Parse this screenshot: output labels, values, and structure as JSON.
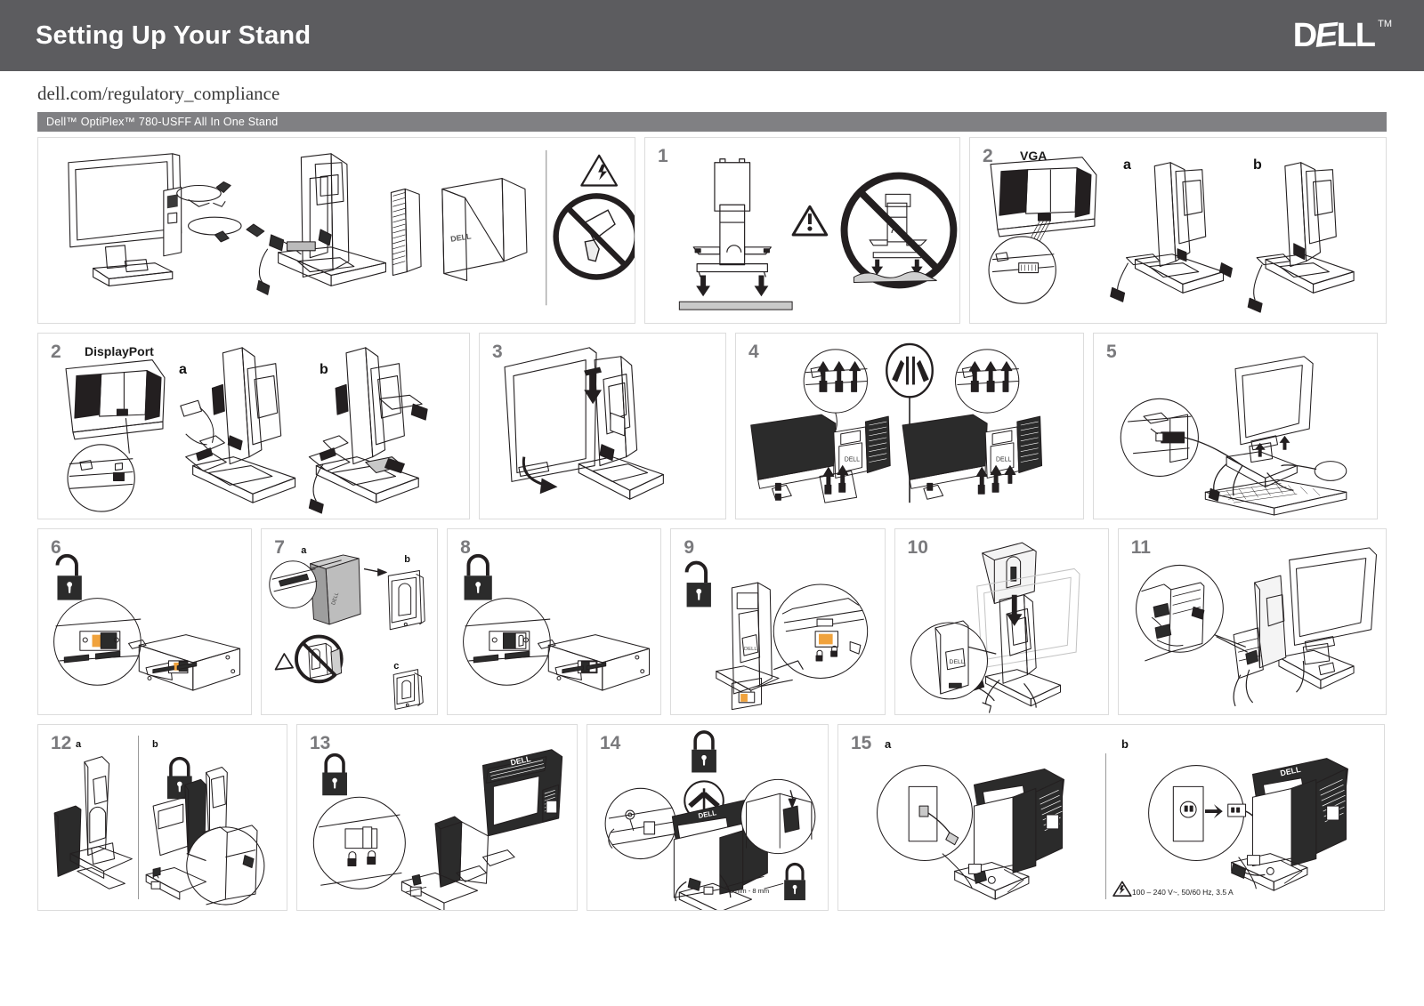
{
  "header": {
    "title": "Setting Up Your Stand",
    "logo_text": "DELL",
    "logo_tm": "TM"
  },
  "compliance_url": "dell.com/regulatory_compliance",
  "subtitle": "Dell™ OptiPlex™ 780-USFF All In One Stand",
  "panels": {
    "intro": {
      "name": "overview-parts",
      "caption_icons": [
        "electrical-hazard-triangle",
        "no-liquids-prohibition"
      ]
    },
    "p1": {
      "num": "1",
      "label": ""
    },
    "p2vga": {
      "num": "2",
      "label": "VGA",
      "a": "a",
      "b": "b"
    },
    "p2dp": {
      "num": "2",
      "label": "DisplayPort",
      "a": "a",
      "b": "b"
    },
    "p3": {
      "num": "3"
    },
    "p4": {
      "num": "4"
    },
    "p5": {
      "num": "5"
    },
    "p6": {
      "num": "6",
      "lock": "unlocked"
    },
    "p7": {
      "num": "7",
      "a": "a",
      "b": "b",
      "c": "c"
    },
    "p8": {
      "num": "8",
      "lock": "locked"
    },
    "p9": {
      "num": "9",
      "lock": "unlocked"
    },
    "p10": {
      "num": "10"
    },
    "p11": {
      "num": "11"
    },
    "p12": {
      "num": "12",
      "a": "a",
      "b": "b",
      "lock": "locked"
    },
    "p13": {
      "num": "13",
      "lock": "locked"
    },
    "p14": {
      "num": "14",
      "lock": "locked",
      "cable_spec": "Ø 3 mm - 8 mm"
    },
    "p15": {
      "num": "15",
      "a": "a",
      "b": "b",
      "power_rating": "100 – 240 V~, 50/60 Hz, 3.5 A"
    }
  },
  "colors": {
    "header_bg": "#5c5c5f",
    "subtitle_bg": "#808083",
    "panel_border": "#dcdcdc",
    "step_num": "#7a7a7d",
    "switch_orange": "#f0a23c",
    "line_art": "#231f20"
  }
}
